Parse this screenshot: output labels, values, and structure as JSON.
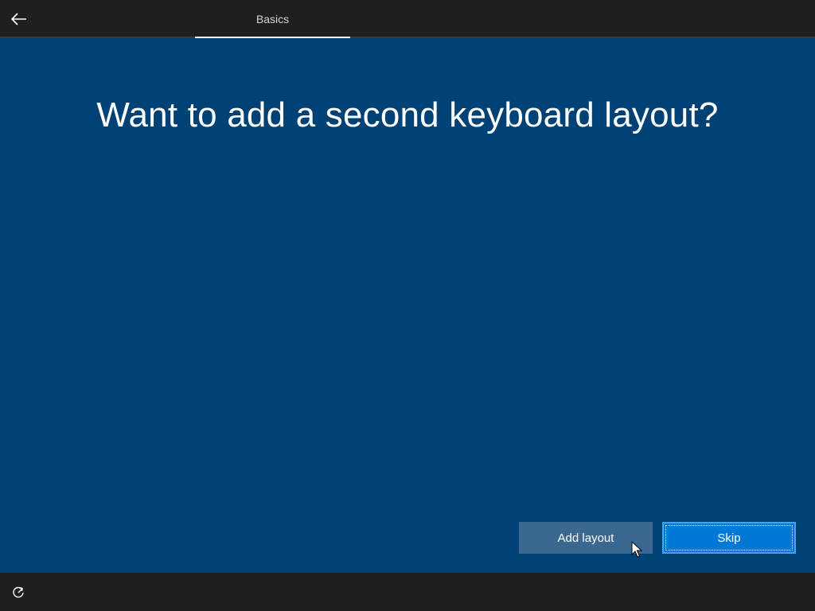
{
  "header": {
    "back_icon": "back-arrow-icon",
    "tab_label": "Basics"
  },
  "main": {
    "title": "Want to add a second keyboard layout?",
    "background_color": "#004275"
  },
  "buttons": {
    "add_layout_label": "Add layout",
    "skip_label": "Skip"
  },
  "footer": {
    "ease_of_access_icon": "ease-of-access-icon"
  },
  "colors": {
    "accent": "#0078d7",
    "secondary_button": "#3a6890",
    "chrome": "#1f1f1f"
  }
}
